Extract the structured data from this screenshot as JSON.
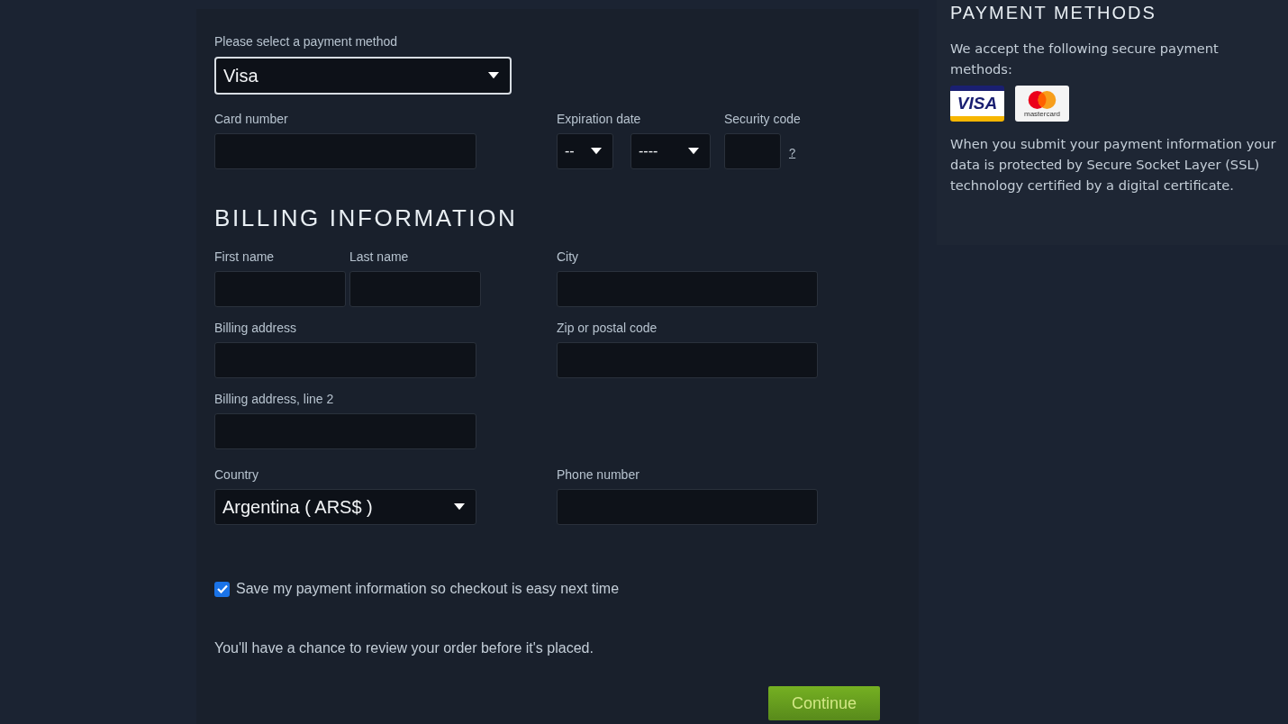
{
  "payment_method": {
    "label": "Please select a payment method",
    "value": "Visa"
  },
  "card_number": {
    "label": "Card number"
  },
  "expiration": {
    "label": "Expiration date",
    "month": "--",
    "year": "----"
  },
  "security_code": {
    "label": "Security code",
    "help": "?"
  },
  "billing": {
    "title": "BILLING INFORMATION",
    "first_name": {
      "label": "First name"
    },
    "last_name": {
      "label": "Last name"
    },
    "city": {
      "label": "City"
    },
    "address": {
      "label": "Billing address"
    },
    "zip": {
      "label": "Zip or postal code"
    },
    "address2": {
      "label": "Billing address, line 2"
    },
    "country": {
      "label": "Country",
      "value": "Argentina ( ARS$ )"
    },
    "phone": {
      "label": "Phone number"
    }
  },
  "save_info": {
    "label": "Save my payment information so checkout is easy next time",
    "checked": true
  },
  "review_note": "You'll have a chance to review your order before it's placed.",
  "continue_button": "Continue",
  "sidebar": {
    "title": "PAYMENT METHODS",
    "intro": "We accept the following secure payment methods:",
    "cards": [
      {
        "kind": "visa",
        "text": "VISA"
      },
      {
        "kind": "mastercard",
        "text": "mastercard"
      }
    ],
    "note": "When you submit your payment information your data is protected by Secure Socket Layer (SSL) technology certified by a digital certificate."
  }
}
